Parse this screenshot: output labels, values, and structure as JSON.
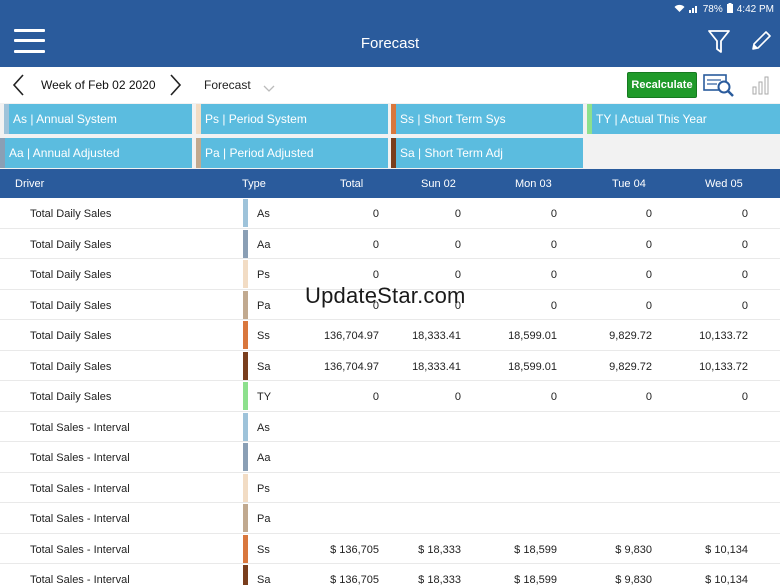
{
  "status": {
    "battery": "78%",
    "time": "4:42 PM"
  },
  "appbar": {
    "title": "Forecast"
  },
  "toolbar": {
    "week_label": "Week of Feb 02 2020",
    "forecast_select": "Forecast",
    "recalculate_label": "Recalculate"
  },
  "legend": {
    "chips": [
      {
        "label": "As | Annual System",
        "bar_color": "#9ec3da"
      },
      {
        "label": "Ps | Period System",
        "bar_color": "#f2dcc4"
      },
      {
        "label": "Ss | Short Term Sys",
        "bar_color": "#d9773d"
      },
      {
        "label": "TY | Actual This Year",
        "bar_color": "#8de08d"
      },
      {
        "label": "Aa | Annual Adjusted",
        "bar_color": "#8a9fb5"
      },
      {
        "label": "Pa | Period Adjusted",
        "bar_color": "#c1a98f"
      },
      {
        "label": "Sa | Short Term Adj",
        "bar_color": "#7a3e1d"
      }
    ]
  },
  "table": {
    "headers": [
      "Driver",
      "Type",
      "Total",
      "Sun 02",
      "Mon 03",
      "Tue 04",
      "Wed 05"
    ],
    "rows": [
      {
        "driver": "Total Daily Sales",
        "type": "As",
        "values": [
          "0",
          "0",
          "0",
          "0",
          "0"
        ]
      },
      {
        "driver": "Total Daily Sales",
        "type": "Aa",
        "values": [
          "0",
          "0",
          "0",
          "0",
          "0"
        ]
      },
      {
        "driver": "Total Daily Sales",
        "type": "Ps",
        "values": [
          "0",
          "0",
          "0",
          "0",
          "0"
        ]
      },
      {
        "driver": "Total Daily Sales",
        "type": "Pa",
        "values": [
          "0",
          "0",
          "0",
          "0",
          "0"
        ]
      },
      {
        "driver": "Total Daily Sales",
        "type": "Ss",
        "values": [
          "136,704.97",
          "18,333.41",
          "18,599.01",
          "9,829.72",
          "10,133.72"
        ]
      },
      {
        "driver": "Total Daily Sales",
        "type": "Sa",
        "values": [
          "136,704.97",
          "18,333.41",
          "18,599.01",
          "9,829.72",
          "10,133.72"
        ]
      },
      {
        "driver": "Total Daily Sales",
        "type": "TY",
        "values": [
          "0",
          "0",
          "0",
          "0",
          "0"
        ]
      },
      {
        "driver": "Total Sales - Interval",
        "type": "As",
        "values": [
          "",
          "",
          "",
          "",
          ""
        ]
      },
      {
        "driver": "Total Sales - Interval",
        "type": "Aa",
        "values": [
          "",
          "",
          "",
          "",
          ""
        ]
      },
      {
        "driver": "Total Sales - Interval",
        "type": "Ps",
        "values": [
          "",
          "",
          "",
          "",
          ""
        ]
      },
      {
        "driver": "Total Sales - Interval",
        "type": "Pa",
        "values": [
          "",
          "",
          "",
          "",
          ""
        ]
      },
      {
        "driver": "Total Sales - Interval",
        "type": "Ss",
        "values": [
          "$ 136,705",
          "$ 18,333",
          "$ 18,599",
          "$ 9,830",
          "$ 10,134"
        ]
      },
      {
        "driver": "Total Sales - Interval",
        "type": "Sa",
        "values": [
          "$ 136,705",
          "$ 18,333",
          "$ 18,599",
          "$ 9,830",
          "$ 10,134"
        ]
      }
    ]
  },
  "type_colors": {
    "As": "#9ec3da",
    "Aa": "#8a9fb5",
    "Ps": "#f2dcc4",
    "Pa": "#c1a98f",
    "Ss": "#d9773d",
    "Sa": "#7a3e1d",
    "TY": "#8de08d"
  },
  "watermark": "UpdateStar.com"
}
